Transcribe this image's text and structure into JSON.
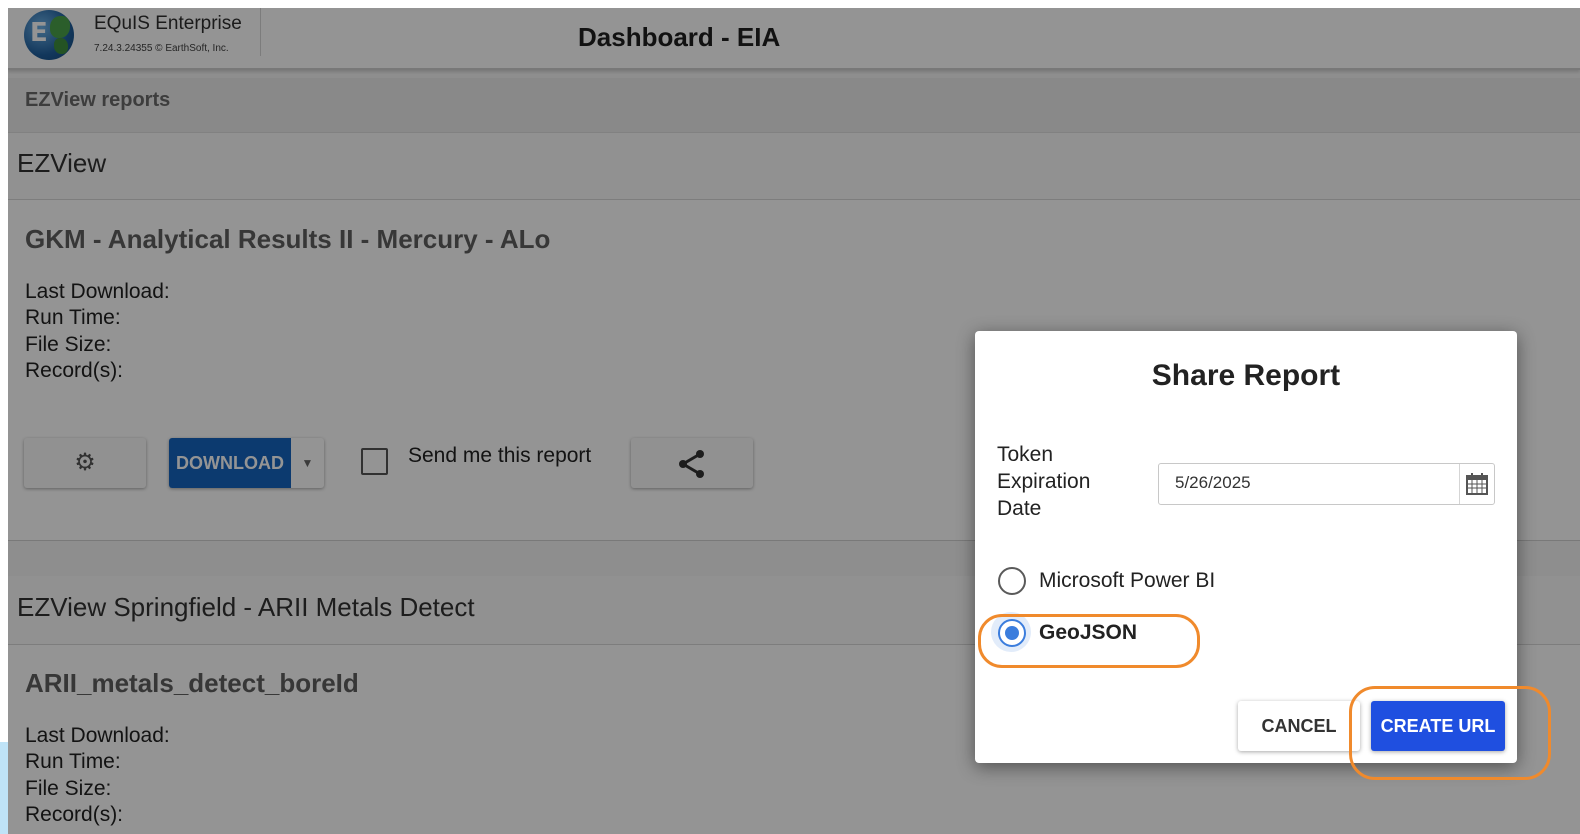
{
  "app": {
    "brand_name": "EQuIS Enterprise",
    "version": "7.24.3.24355 © EarthSoft, Inc.",
    "logo_letter": "E"
  },
  "header": {
    "title": "Dashboard - EIA"
  },
  "section": {
    "label": "EZView reports"
  },
  "groups": [
    {
      "title": "EZView",
      "report": {
        "title": "GKM - Analytical Results II - Mercury - ALo",
        "meta": [
          "Last Download:",
          "Run Time:",
          "File Size:",
          "Record(s):"
        ],
        "download_label": "DOWNLOAD",
        "send_label": "Send me this report"
      }
    },
    {
      "title": "EZView Springfield - ARII Metals Detect",
      "report": {
        "title": "ARII_metals_detect_boreId",
        "meta": [
          "Last Download:",
          "Run Time:",
          "File Size:",
          "Record(s):"
        ]
      }
    }
  ],
  "dialog": {
    "title": "Share Report",
    "token_label": "Token Expiration Date",
    "date_value": "5/26/2025",
    "options": [
      {
        "label": "Microsoft Power BI",
        "selected": false
      },
      {
        "label": "GeoJSON",
        "selected": true
      }
    ],
    "cancel_label": "CANCEL",
    "create_label": "CREATE URL"
  },
  "colors": {
    "primary": "#1565c0",
    "create_button": "#1f4fe0",
    "radio_selected": "#3b7ddd",
    "highlight": "#f08a2c"
  },
  "icons": [
    "gear-icon",
    "caret-down-icon",
    "share-icon",
    "calendar-icon"
  ]
}
